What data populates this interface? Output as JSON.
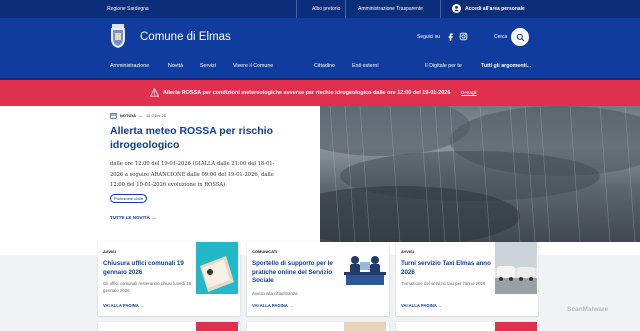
{
  "topbar": {
    "region": "Regione Sardegna",
    "links": [
      "Albo pretorio",
      "Amministrazione Trasparente"
    ],
    "login": "Accedi all'area personale"
  },
  "header": {
    "title": "Comune di Elmas",
    "follow_label": "Seguici su",
    "search_label": "Cerca"
  },
  "nav": {
    "left": [
      "Amministrazione",
      "Novità",
      "Servizi",
      "Vivere il Comune"
    ],
    "right": [
      "Cittadino",
      "Enti esterni",
      "Il Digitale per te",
      "Tutti gli argomenti..."
    ]
  },
  "alert": {
    "text": "Allerta ROSSA per condizioni metereologiche avverse per rischio idrogeologico dalle ore 12:00 del 19-01-2026",
    "link": "Dettagli"
  },
  "news": {
    "type": "NOTIZIA",
    "date": "18 GEN 26",
    "title": "Allerta meteo ROSSA per rischio idrogeologico",
    "body": "dalle ore 12:00 del 19-01-2026 (GIALLA dalle 21:00 del 18-01-2026 a seguire ARANCIONE dalle 09:00 del 19-01-2026, dalle 12:00 del 19-01-2026 evoluzione in ROSSA)",
    "tag": "Protezione civile",
    "all_link": "TUTTE LE NOVITÀ"
  },
  "cards": [
    {
      "category": "AVVISI",
      "title": "Chiusura uffici comunali 19 gennaio 2026",
      "description": "Gli uffici comunali resteranno chiusi lunedì 19 gennaio 2026",
      "link": "VAI ALLA PAGINA"
    },
    {
      "category": "COMUNICATI",
      "title": "Sportello di supporto per le pratiche online del Servizio Sociale",
      "description": "Avviso alla cittadinanza",
      "link": "VAI ALLA PAGINA"
    },
    {
      "category": "AVVISI",
      "title": "Turni servizio Taxi Elmas anno 2026",
      "description": "Turnazione del servizio taxi per l'anno 2026",
      "link": "VAI ALLA PAGINA"
    }
  ],
  "watermark": "ScanMalware",
  "colors": {
    "primary": "#0f3c9e",
    "topbar": "#0b2e7a",
    "alert": "#e0304d"
  }
}
